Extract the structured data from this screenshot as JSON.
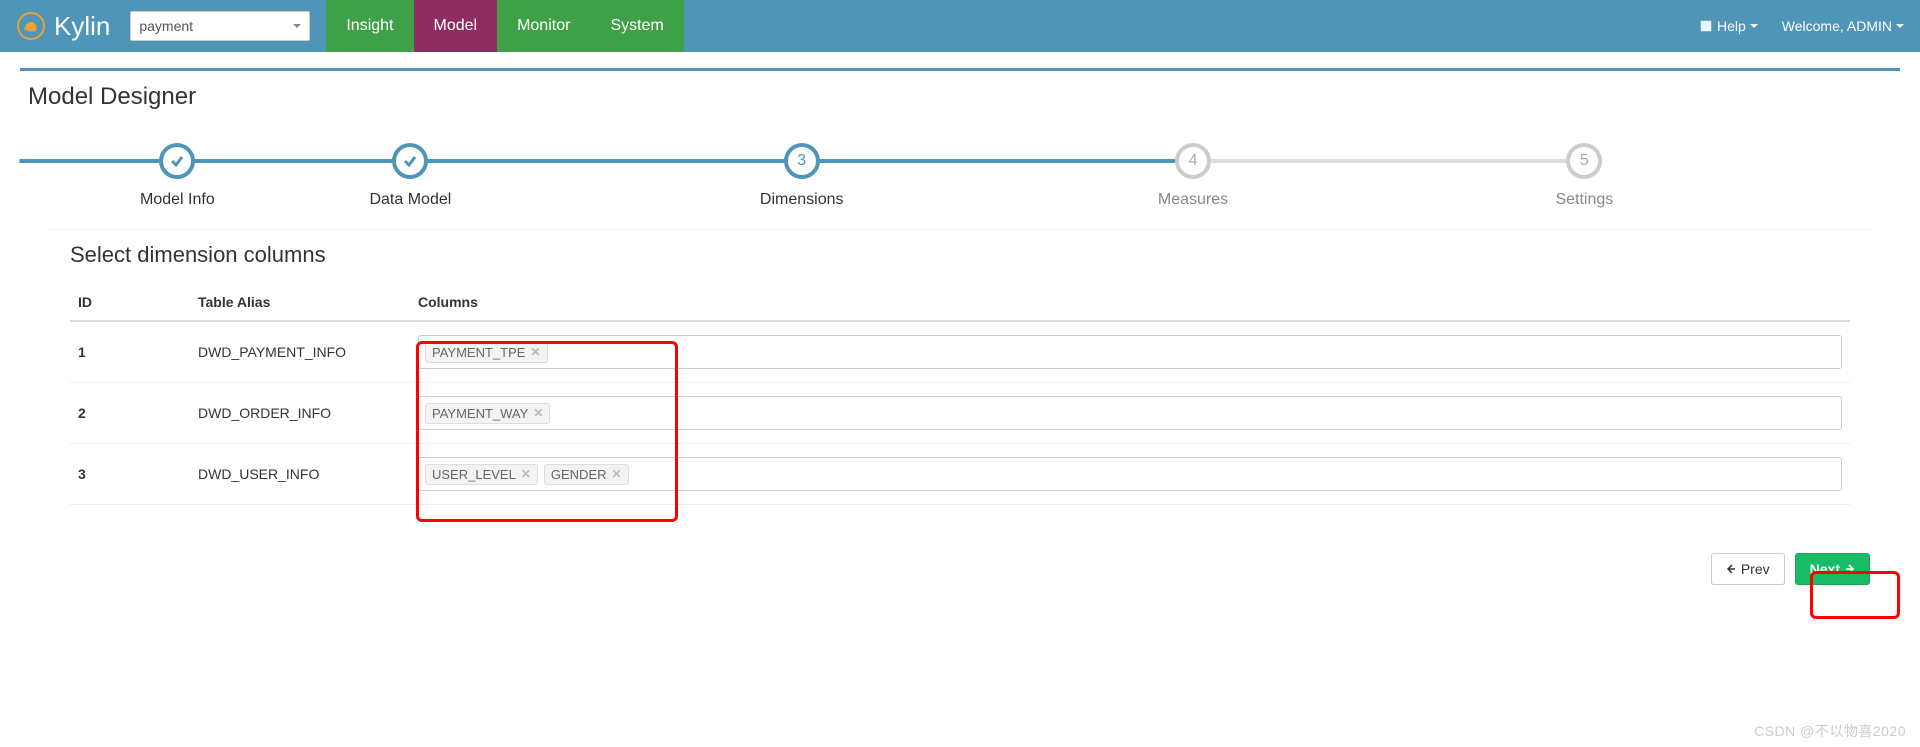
{
  "header": {
    "brand": "Kylin",
    "project": "payment",
    "nav": {
      "insight": "Insight",
      "model": "Model",
      "monitor": "Monitor",
      "system": "System"
    },
    "help": "Help",
    "welcome": "Welcome, ADMIN"
  },
  "page": {
    "title": "Model Designer",
    "section_title": "Select dimension columns"
  },
  "wizard": {
    "steps": [
      {
        "label": "Model Info",
        "state": "done"
      },
      {
        "label": "Data Model",
        "state": "done"
      },
      {
        "label": "Dimensions",
        "state": "active",
        "num": "3"
      },
      {
        "label": "Measures",
        "state": "todo",
        "num": "4"
      },
      {
        "label": "Settings",
        "state": "todo",
        "num": "5"
      }
    ]
  },
  "table": {
    "headers": {
      "id": "ID",
      "alias": "Table Alias",
      "columns": "Columns"
    },
    "rows": [
      {
        "id": "1",
        "alias": "DWD_PAYMENT_INFO",
        "tags": [
          "PAYMENT_TPE"
        ]
      },
      {
        "id": "2",
        "alias": "DWD_ORDER_INFO",
        "tags": [
          "PAYMENT_WAY"
        ]
      },
      {
        "id": "3",
        "alias": "DWD_USER_INFO",
        "tags": [
          "USER_LEVEL",
          "GENDER"
        ]
      }
    ]
  },
  "footer": {
    "prev": "Prev",
    "next": "Next"
  },
  "watermark": "CSDN @不以物喜2020"
}
